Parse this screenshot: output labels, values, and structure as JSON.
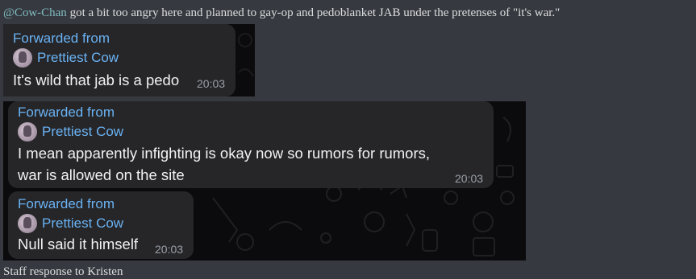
{
  "post": {
    "mention": "@Cow-Chan",
    "text": " got a bit too angry here and planned to gay-op and pedoblanket JAB under the pretenses of \"it's war.\""
  },
  "screenshot1": {
    "messages": [
      {
        "forwarded": "Forwarded from",
        "sender": "Prettiest Cow",
        "text": "It's wild that jab is a pedo",
        "time": "20:03"
      }
    ]
  },
  "screenshot2": {
    "messages": [
      {
        "forwarded": "Forwarded from",
        "sender": "Prettiest Cow",
        "line1": "I mean apparently infighting is okay now so rumors for rumors,",
        "line2": "war is allowed on the site",
        "time": "20:03"
      },
      {
        "forwarded": "Forwarded from",
        "sender": "Prettiest Cow",
        "text": "Null said it himself",
        "time": "20:03"
      }
    ]
  },
  "footer": {
    "partial_text": "Staff response to Kristen"
  }
}
